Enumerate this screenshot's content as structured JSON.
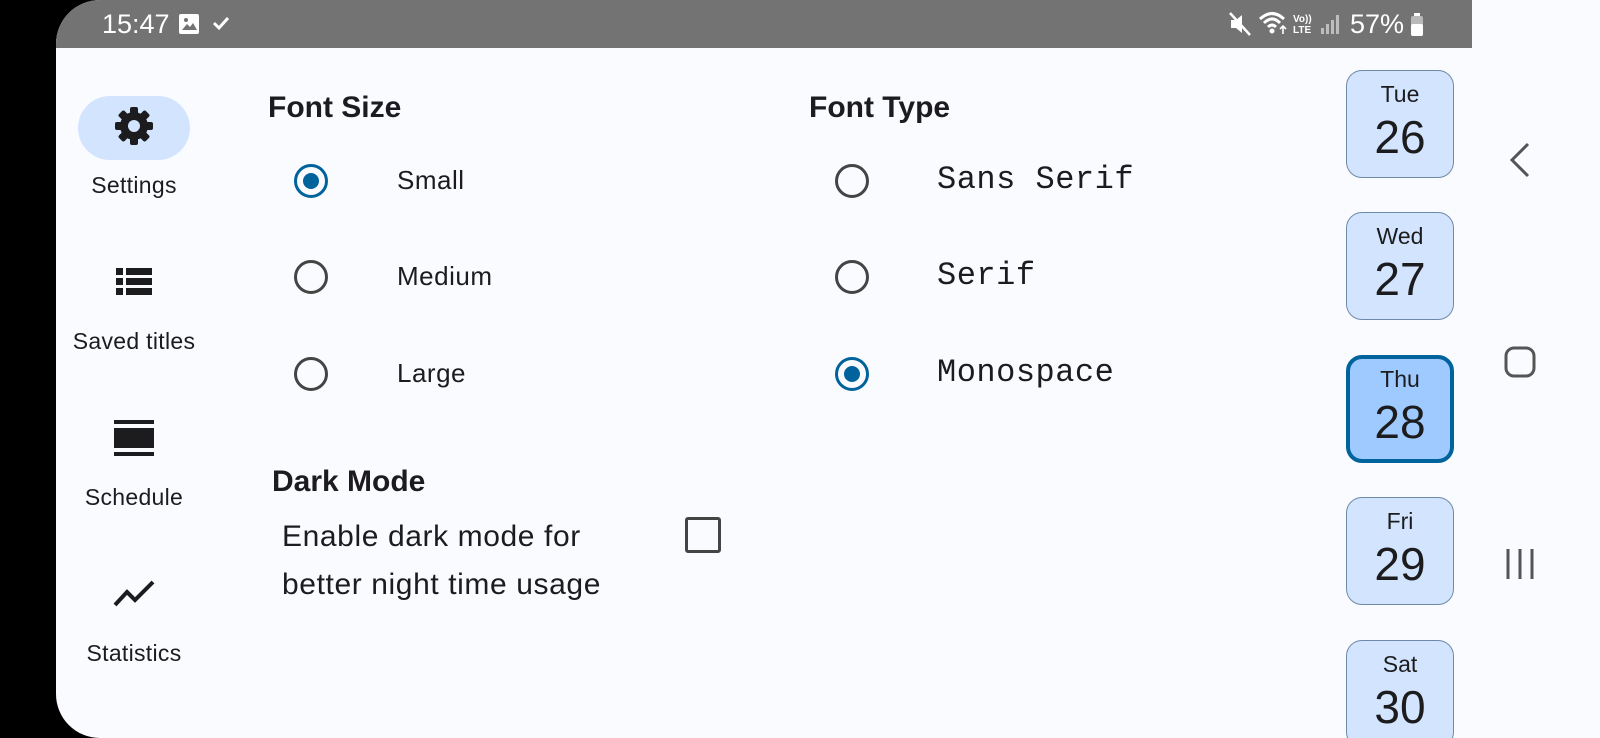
{
  "status_bar": {
    "time": "15:47",
    "battery": "57%",
    "icons_left": [
      "image-icon",
      "check-icon"
    ],
    "icons_right": [
      "mute-icon",
      "wifi-icon",
      "volte-icon",
      "signal-icon",
      "battery-icon"
    ]
  },
  "nav_rail": {
    "items": [
      {
        "label": "Settings",
        "icon": "gear-icon",
        "active": true
      },
      {
        "label": "Saved titles",
        "icon": "list-icon",
        "active": false
      },
      {
        "label": "Schedule",
        "icon": "schedule-icon",
        "active": false
      },
      {
        "label": "Statistics",
        "icon": "chart-line-icon",
        "active": false
      }
    ]
  },
  "font_size": {
    "title": "Font Size",
    "options": [
      {
        "label": "Small",
        "checked": true
      },
      {
        "label": "Medium",
        "checked": false
      },
      {
        "label": "Large",
        "checked": false
      }
    ]
  },
  "font_type": {
    "title": "Font Type",
    "options": [
      {
        "label": "Sans Serif",
        "checked": false
      },
      {
        "label": "Serif",
        "checked": false
      },
      {
        "label": "Monospace",
        "checked": true
      }
    ]
  },
  "dark_mode": {
    "title": "Dark Mode",
    "line1": "Enable dark mode for",
    "line2": "better night time usage",
    "checked": false
  },
  "days": [
    {
      "name": "Tue",
      "num": "26",
      "selected": false
    },
    {
      "name": "Wed",
      "num": "27",
      "selected": false
    },
    {
      "name": "Thu",
      "num": "28",
      "selected": true
    },
    {
      "name": "Fri",
      "num": "29",
      "selected": false
    },
    {
      "name": "Sat",
      "num": "30",
      "selected": false
    }
  ],
  "system_nav": [
    "back-icon",
    "home-icon",
    "recents-icon"
  ],
  "colors": {
    "accent": "#00639b",
    "card": "#d3e4ff",
    "card_selected": "#9ecaff",
    "status_bar": "#737373"
  }
}
